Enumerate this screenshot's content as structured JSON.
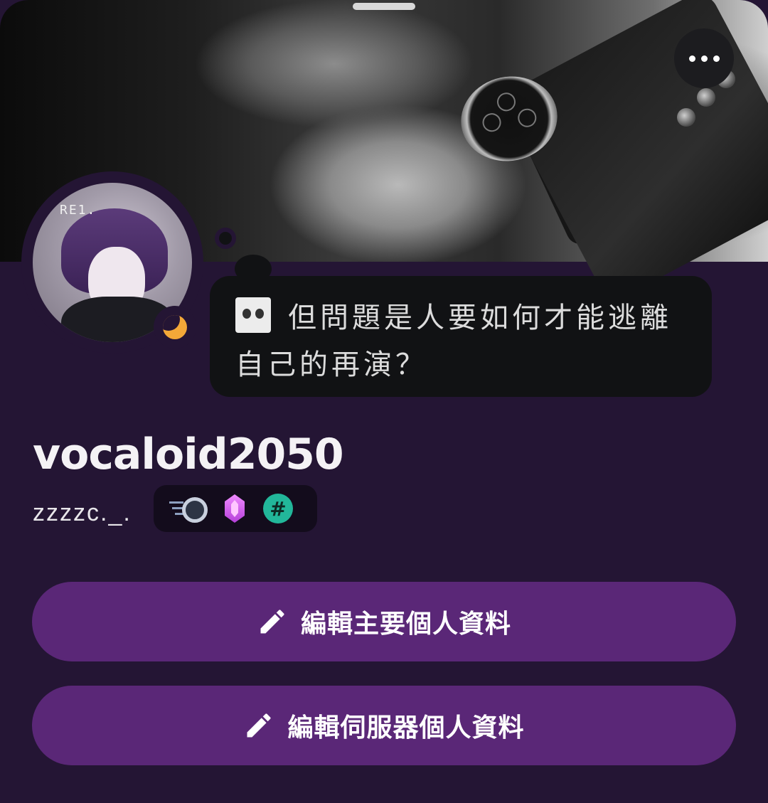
{
  "header": {
    "more_menu": "more-options-icon"
  },
  "avatar": {
    "overlay_text": "RE1.",
    "status": "idle-moon-icon",
    "status_color": "#f3a838"
  },
  "custom_status": {
    "emoji": "panda-face-emoji",
    "text": "但問題是人要如何才能逃離自己的再演？"
  },
  "profile": {
    "display_name": "vocaloid2050",
    "username": "zzzzc._.",
    "badges": [
      {
        "name": "nitro-badge-icon"
      },
      {
        "name": "server-boost-gem-icon",
        "color": "#e06cf5"
      },
      {
        "name": "hashtag-badge-icon",
        "label": "#",
        "color": "#22b79a"
      }
    ]
  },
  "actions": {
    "edit_main_profile": "編輯主要個人資料",
    "edit_server_profile": "編輯伺服器個人資料",
    "accent_color": "#5a2777"
  },
  "colors": {
    "background": "#241534",
    "bubble": "#111214"
  }
}
